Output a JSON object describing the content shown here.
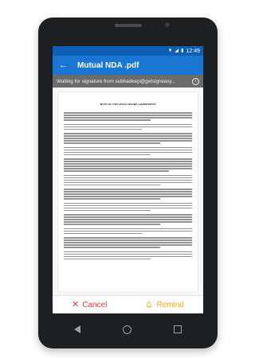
{
  "status_bar": {
    "time": "12:49"
  },
  "toolbar": {
    "title": "Mutual NDA .pdf"
  },
  "banner": {
    "text": "Waiting for signature from subhadeep@getsigneasy..."
  },
  "document": {
    "heading": "MUTUAL NON-DISCLOSURE AGREEMENT"
  },
  "actions": {
    "cancel_label": "Cancel",
    "remind_label": "Remind"
  },
  "colors": {
    "primary": "#1976d2",
    "status_bar": "#0d5fb4",
    "cancel": "#e53935",
    "remind": "#f5a623",
    "banner": "#6b6b6b"
  },
  "icons": {
    "back": "arrow-left-icon",
    "info": "info-icon",
    "cancel": "close-icon",
    "remind": "bell-icon"
  }
}
